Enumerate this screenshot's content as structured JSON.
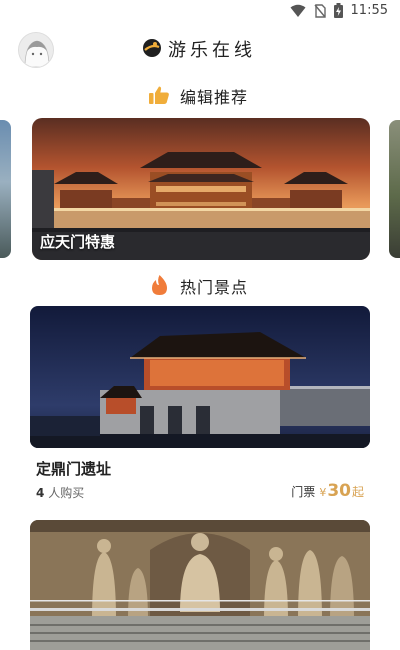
{
  "status_bar": {
    "time": "11:55",
    "icons": [
      "wifi-icon",
      "no-sim-icon",
      "battery-charging-icon"
    ]
  },
  "header": {
    "title": "游乐在线",
    "avatar_icon": "avatar",
    "logo_icon": "travel-logo-icon"
  },
  "editor_picks": {
    "icon": "thumbs-up-icon",
    "label": "编辑推荐",
    "items": [
      {
        "caption": "应天门特惠"
      }
    ]
  },
  "hot_spots": {
    "icon": "flame-icon",
    "label": "热门景点",
    "items": [
      {
        "name": "定鼎门遗址",
        "buyers_count": "4",
        "buyers_suffix": "人购买",
        "price_label": "门票",
        "currency": "¥",
        "price": "30",
        "price_suffix": "起"
      }
    ]
  },
  "colors": {
    "accent_orange": "#f0ad3a",
    "flame": "#f07c3a",
    "price": "#d8a353",
    "text": "#222222"
  }
}
